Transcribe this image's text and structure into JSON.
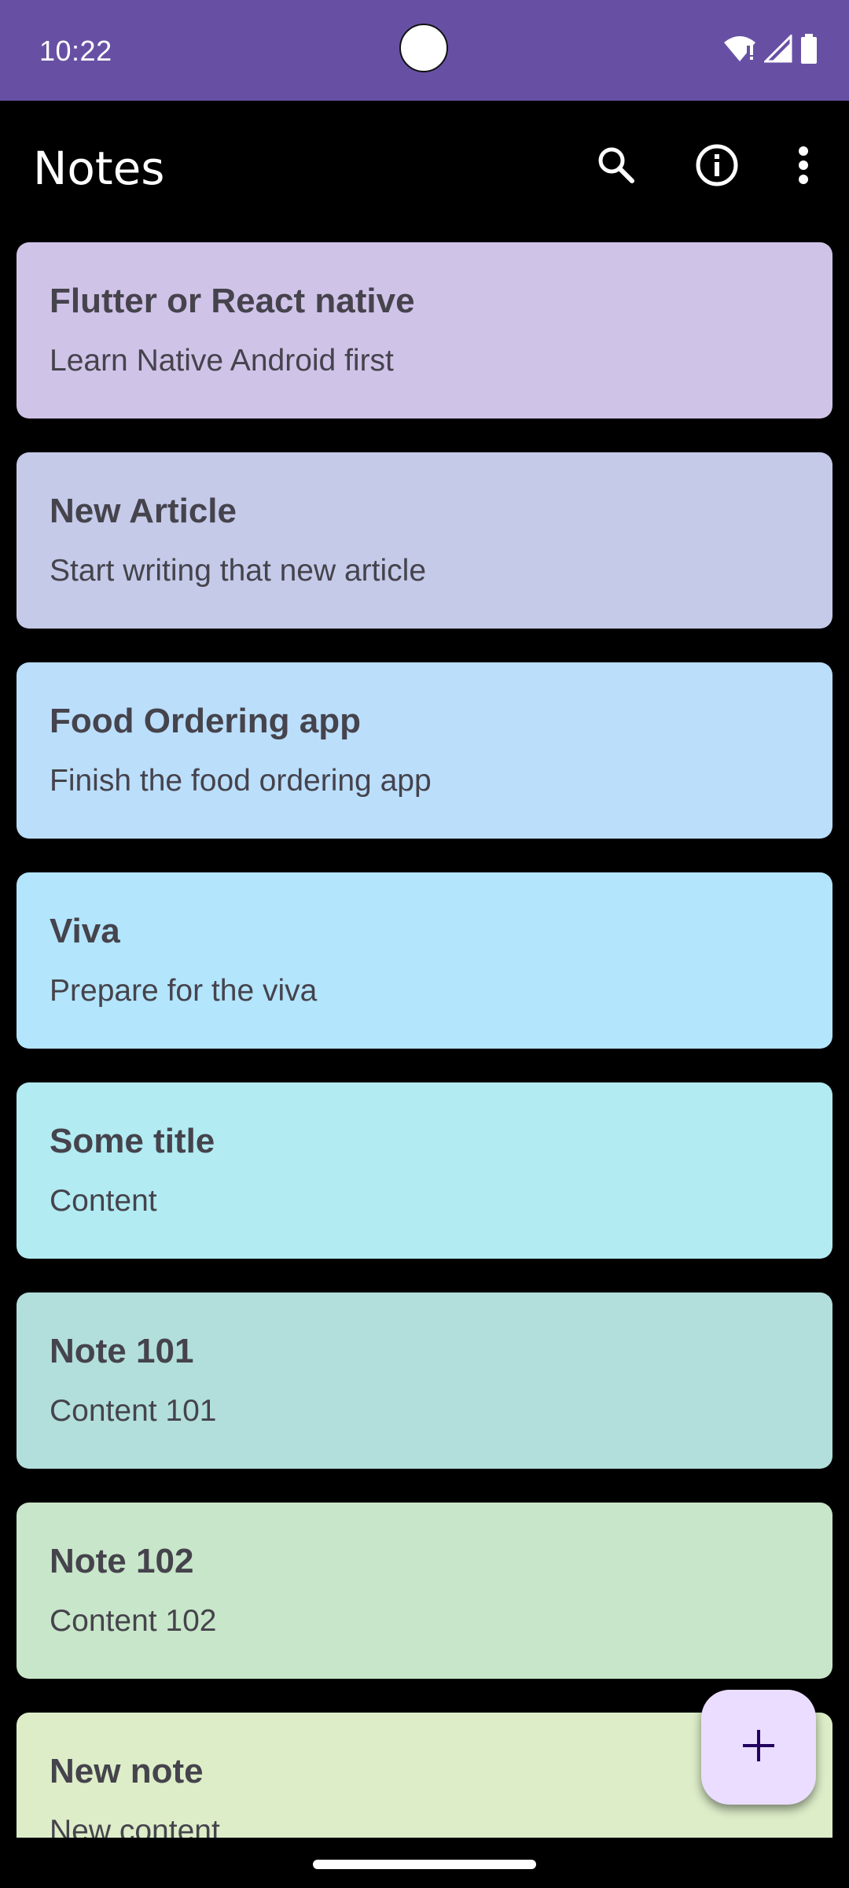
{
  "status_bar": {
    "time": "10:22",
    "background": "#6750A4",
    "icons": [
      "wifi-icon",
      "signal-icon",
      "battery-icon"
    ]
  },
  "app_bar": {
    "title": "Notes",
    "actions": [
      "search-icon",
      "info-icon",
      "more-vert-icon"
    ]
  },
  "notes": [
    {
      "title": "Flutter or React native",
      "content": "Learn Native Android first",
      "color": "#D0C3E8"
    },
    {
      "title": "New Article",
      "content": "Start writing that new article",
      "color": "#C5CAE9"
    },
    {
      "title": "Food Ordering app",
      "content": "Finish the food ordering app",
      "color": "#BBDEFB"
    },
    {
      "title": "Viva",
      "content": "Prepare for the viva",
      "color": "#B3E5FC"
    },
    {
      "title": "Some title",
      "content": "Content",
      "color": "#B2EBF2"
    },
    {
      "title": "Note 101",
      "content": "Content 101",
      "color": "#B2DFDB"
    },
    {
      "title": "Note 102",
      "content": "Content 102",
      "color": "#C8E6C9"
    },
    {
      "title": "New note",
      "content": "New content",
      "color": "#DCEDC8"
    }
  ],
  "fab": {
    "icon": "add-icon",
    "background": "#EADDFF",
    "icon_color": "#21005D"
  }
}
